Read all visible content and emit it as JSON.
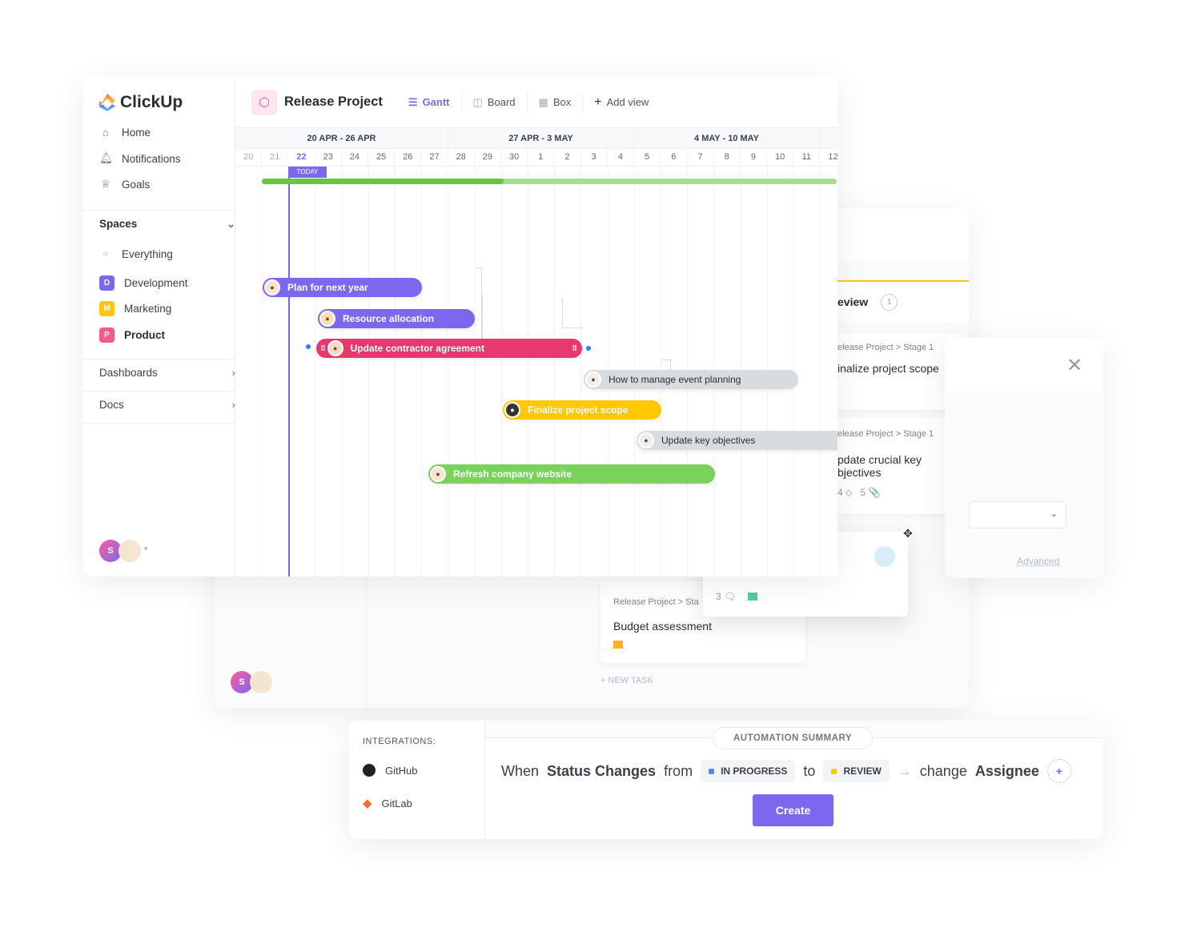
{
  "colors": {
    "accent": "#7b68ee",
    "pink": "#e8396e",
    "yellow": "#ffc800",
    "green": "#79d35a",
    "gray_bar": "#d9dcdf"
  },
  "sidebar": {
    "logo": "ClickUp",
    "nav": [
      {
        "label": "Home",
        "icon": "home-icon"
      },
      {
        "label": "Notifications",
        "icon": "bell-icon"
      },
      {
        "label": "Goals",
        "icon": "trophy-icon"
      }
    ],
    "spaces_label": "Spaces",
    "everything": "Everything",
    "spaces": [
      {
        "letter": "D",
        "label": "Development",
        "color": "#7b68ee"
      },
      {
        "letter": "M",
        "label": "Marketing",
        "color": "#ffc800"
      },
      {
        "letter": "P",
        "label": "Product",
        "color": "#f25b8a"
      }
    ],
    "dashboards": "Dashboards",
    "docs": "Docs",
    "user_initial": "S"
  },
  "header": {
    "project": "Release Project",
    "views": [
      {
        "label": "Gantt",
        "icon": "gantt-icon",
        "active": true
      },
      {
        "label": "Board",
        "icon": "board-icon"
      },
      {
        "label": "Box",
        "icon": "box-icon"
      },
      {
        "label": "Add view",
        "icon": "plus-icon"
      }
    ]
  },
  "gantt": {
    "weeks": [
      "20 APR - 26 APR",
      "27 APR - 3 MAY",
      "4 MAY - 10 MAY"
    ],
    "days": [
      "20",
      "21",
      "22",
      "23",
      "24",
      "25",
      "26",
      "27",
      "28",
      "29",
      "30",
      "1",
      "2",
      "3",
      "4",
      "5",
      "6",
      "7",
      "8",
      "9",
      "10",
      "11",
      "12"
    ],
    "today_label": "TODAY",
    "today": "22",
    "progress_percent": 42,
    "tasks": [
      {
        "name": "Plan for next year",
        "color": "#7b68ee"
      },
      {
        "name": "Resource allocation",
        "color": "#7b68ee"
      },
      {
        "name": "Update contractor agreement",
        "color": "#e8396e"
      },
      {
        "name": "How to manage event planning",
        "color": "#d9dcdf"
      },
      {
        "name": "Finalize project scope",
        "color": "#ffc800"
      },
      {
        "name": "Update key objectives",
        "color": "#d9dcdf"
      },
      {
        "name": "Refresh company website",
        "color": "#79d35a"
      }
    ]
  },
  "board": {
    "column": "eview",
    "count": "1",
    "cards": [
      {
        "crumb": "elease Project > Stage 1",
        "title": "inalize project scope"
      },
      {
        "crumb": "elease Project > Stage 1",
        "title": "pdate crucial key bjectives",
        "tags": "4",
        "attachments": "5"
      },
      {
        "crumb": "Release Project > Sta",
        "title": "Budget assessment"
      }
    ],
    "comments": "3",
    "new_task": "+ NEW TASK",
    "advanced": "Advanced"
  },
  "integrations": {
    "label": "INTEGRATIONS:",
    "items": [
      "GitHub",
      "GitLab"
    ]
  },
  "automation": {
    "badge": "AUTOMATION SUMMARY",
    "when": "When",
    "trigger": "Status Changes",
    "from": "from",
    "status_from": "IN PROGRESS",
    "to": "to",
    "status_to": "REVIEW",
    "action": "change",
    "target": "Assignee",
    "create": "Create"
  }
}
